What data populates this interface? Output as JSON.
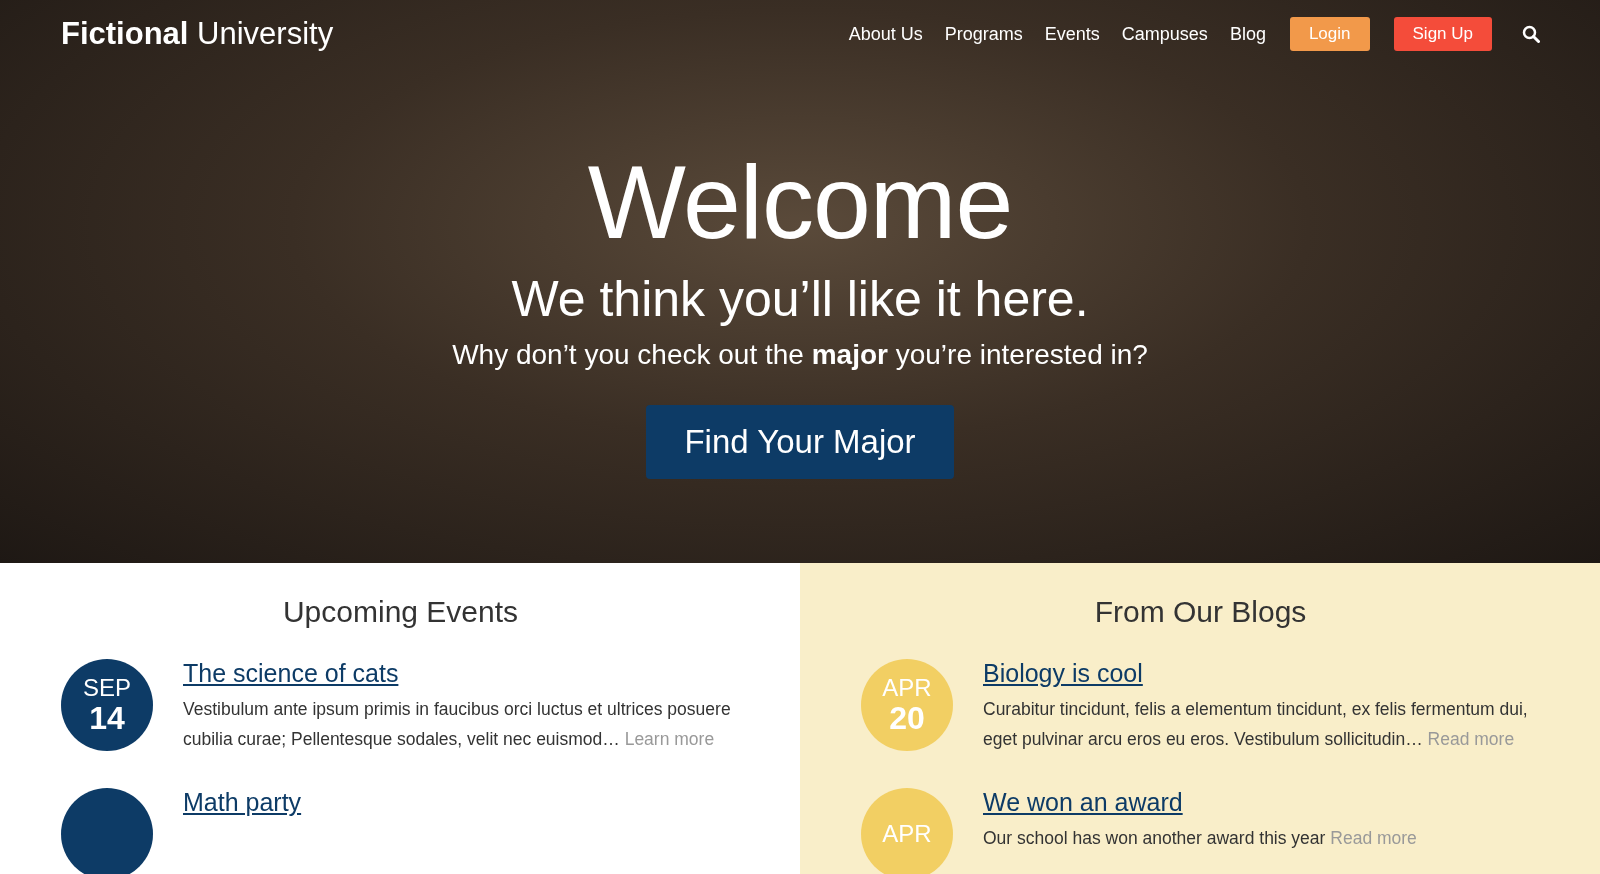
{
  "header": {
    "logo_bold": "Fictional",
    "logo_light": "University",
    "nav": [
      "About Us",
      "Programs",
      "Events",
      "Campuses",
      "Blog"
    ],
    "login": "Login",
    "signup": "Sign Up"
  },
  "hero": {
    "title": "Welcome",
    "subtitle": "We think you’ll like it here.",
    "text": "Why don’t you check out the **major** you’re interested in?",
    "button": "Find Your Major"
  },
  "events": {
    "heading": "Upcoming Events",
    "items": [
      {
        "month": "SEP",
        "day": "14",
        "title": "The science of cats",
        "excerpt": "Vestibulum ante ipsum primis in faucibus orci luctus et ultrices posuere cubilia curae; Pellentesque sodales, velit nec euismod…",
        "link": "Learn more"
      },
      {
        "title": "Math party"
      }
    ]
  },
  "blogs": {
    "heading": "From Our Blogs",
    "items": [
      {
        "month": "APR",
        "day": "20",
        "title": "Biology is cool",
        "excerpt": "Curabitur tincidunt, felis a elementum tincidunt, ex felis fermentum dui, eget pulvinar arcu eros eu eros. Vestibulum sollicitudin…",
        "link": "Read more"
      },
      {
        "month": "APR",
        "title": "We won an award",
        "excerpt": "Our school has won another award this year",
        "link": "Read more"
      }
    ]
  }
}
